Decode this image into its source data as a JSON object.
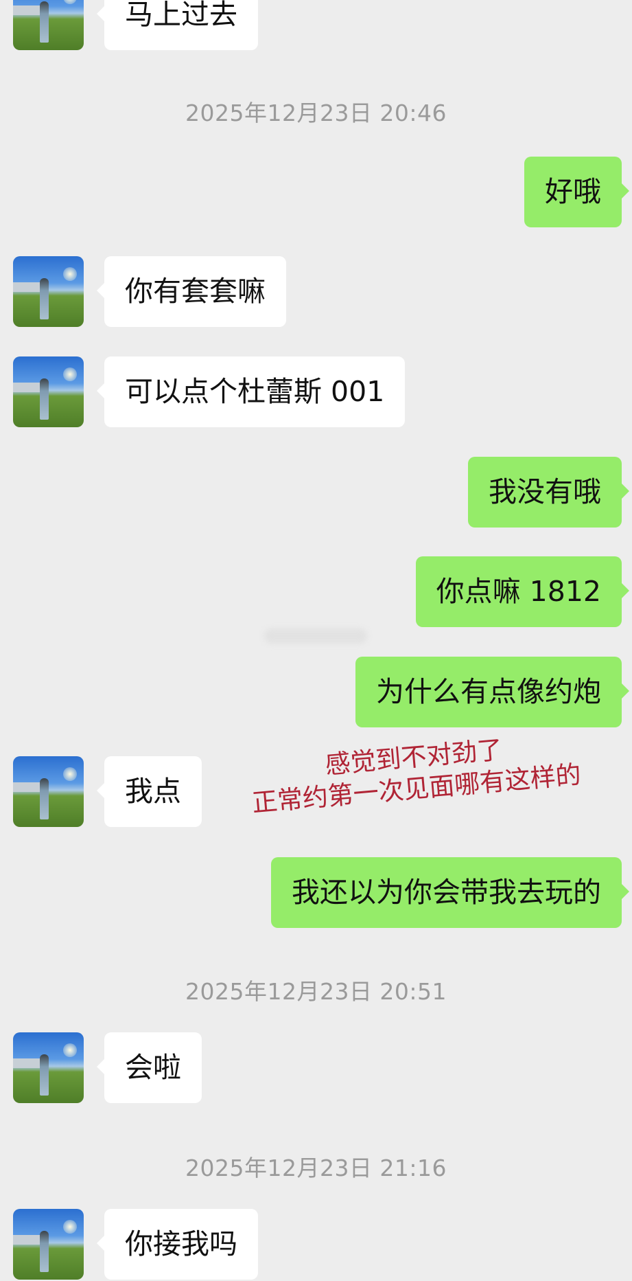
{
  "timestamps": [
    "2025年12月23日 20:46",
    "2025年12月23日 20:51",
    "2025年12月23日 21:16"
  ],
  "messages": {
    "m0": {
      "side": "in",
      "text": "马上过去"
    },
    "m1": {
      "side": "out",
      "text": "好哦"
    },
    "m2": {
      "side": "in",
      "text": "你有套套嘛"
    },
    "m3": {
      "side": "in",
      "text": "可以点个杜蕾斯 001"
    },
    "m4": {
      "side": "out",
      "text": "我没有哦"
    },
    "m5": {
      "side": "out",
      "text": "你点嘛 1812"
    },
    "m6": {
      "side": "out",
      "text": "为什么有点像约炮"
    },
    "m7": {
      "side": "in",
      "text": "我点"
    },
    "m8": {
      "side": "out",
      "text": "我还以为你会带我去玩的"
    },
    "m9": {
      "side": "in",
      "text": "会啦"
    },
    "m10": {
      "side": "in",
      "text": "你接我吗"
    }
  },
  "annotation": {
    "line1": "感觉到不对劲了",
    "line2": "正常约第一次见面哪有这样的",
    "color": "#b02435"
  },
  "colors": {
    "background": "#ededed",
    "outgoing_bubble": "#95ec69",
    "incoming_bubble": "#ffffff",
    "timestamp": "#9a9a9a"
  }
}
